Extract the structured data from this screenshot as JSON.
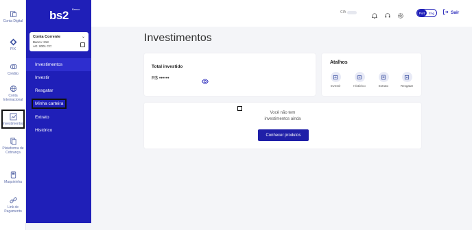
{
  "rail": [
    {
      "name": "rail-conta-digital",
      "icon": "bank-icon",
      "label": "Conta Digital"
    },
    {
      "name": "rail-pix",
      "icon": "pix-icon",
      "label": "PIX"
    },
    {
      "name": "rail-credito",
      "icon": "credit-icon",
      "label": "Crédito"
    },
    {
      "name": "rail-conta-internacional",
      "icon": "globe-icon",
      "label": "Conta Internacional"
    },
    {
      "name": "rail-investimentos",
      "icon": "chart-icon",
      "label": "Investimentos"
    },
    {
      "name": "rail-plataforma-cobranca",
      "icon": "billing-icon",
      "label": "Plataforma de Cobrança"
    },
    {
      "name": "rail-maquininha",
      "icon": "card-machine-icon",
      "label": "Maquininha"
    },
    {
      "name": "rail-link-pagamento",
      "icon": "link-icon",
      "label": "Link de Pagamento"
    }
  ],
  "sidebar": {
    "logo": "bs2",
    "logo_sub": "Banco",
    "account": {
      "title": "Conta Corrente",
      "bank": "Banco: 218",
      "agency": "AG: 0001  CC:"
    },
    "items": [
      {
        "label": "Investimentos"
      },
      {
        "label": "Investir"
      },
      {
        "label": "Resgatar"
      },
      {
        "label": "Minha carteira"
      },
      {
        "label": "Extrato"
      },
      {
        "label": "Histórico"
      }
    ]
  },
  "topbar": {
    "search_label": "CIA",
    "lang_on": "Port",
    "lang_off": "Eng",
    "logout": "Sair"
  },
  "main": {
    "title": "Investimentos",
    "total_label": "Total investido",
    "total_value": "R$ ••••••",
    "shortcuts_title": "Atalhos",
    "shortcuts": [
      {
        "label": "Investir"
      },
      {
        "label": "Histórico"
      },
      {
        "label": "Extrato"
      },
      {
        "label": "Resgatar"
      }
    ],
    "empty_line1": "Você não tem",
    "empty_line2": "investimentos ainda",
    "cta": "Conhecer produtos"
  },
  "colors": {
    "brand": "#1f1fb8",
    "active_nav": "#2e2ecf"
  }
}
